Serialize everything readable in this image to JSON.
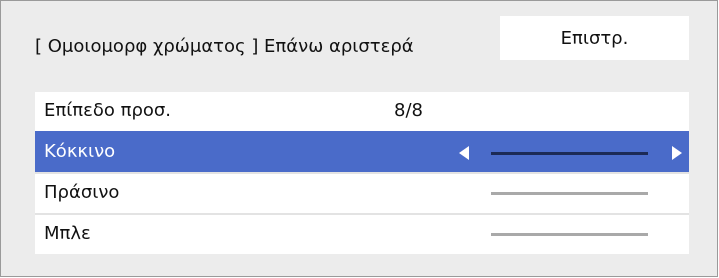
{
  "header": {
    "title": "[ Ομοιομορφ χρώματος ] Επάνω αριστερά",
    "back_label": "Επιστρ."
  },
  "rows": [
    {
      "label": "Επίπεδο προσ.",
      "value": "8/8"
    },
    {
      "label": "Κόκκινο",
      "selected": true,
      "control": "slider"
    },
    {
      "label": "Πράσινο",
      "control": "slider"
    },
    {
      "label": "Μπλε",
      "control": "slider"
    }
  ],
  "icons": {
    "left": "triangle-left-icon",
    "right": "triangle-right-icon"
  },
  "colors": {
    "selection": "#4a6bc9",
    "panel_background": "#ececec"
  }
}
